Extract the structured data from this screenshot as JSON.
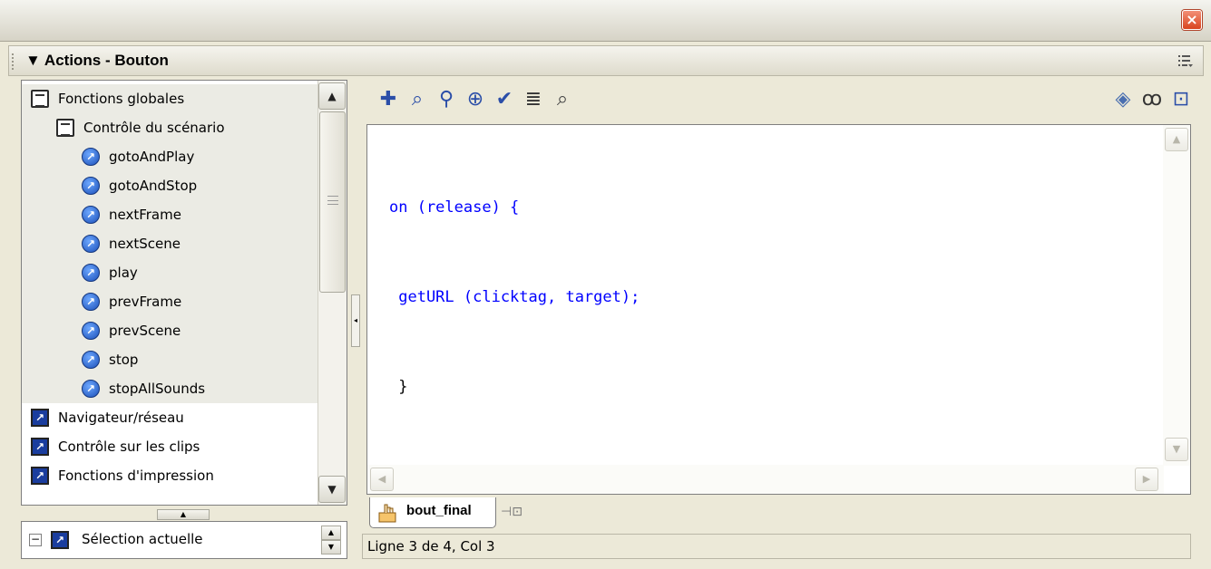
{
  "window": {
    "close_label": "×"
  },
  "panel": {
    "title": "Actions - Bouton"
  },
  "tree": {
    "items": [
      {
        "label": "Fonctions globales",
        "icon": "book-icon",
        "indent": 1
      },
      {
        "label": "Contrôle du scénario",
        "icon": "book-icon",
        "indent": 2
      },
      {
        "label": "gotoAndPlay",
        "icon": "action-circle-icon",
        "indent": 3
      },
      {
        "label": "gotoAndStop",
        "icon": "action-circle-icon",
        "indent": 3
      },
      {
        "label": "nextFrame",
        "icon": "action-circle-icon",
        "indent": 3
      },
      {
        "label": "nextScene",
        "icon": "action-circle-icon",
        "indent": 3
      },
      {
        "label": "play",
        "icon": "action-circle-icon",
        "indent": 3
      },
      {
        "label": "prevFrame",
        "icon": "action-circle-icon",
        "indent": 3
      },
      {
        "label": "prevScene",
        "icon": "action-circle-icon",
        "indent": 3
      },
      {
        "label": "stop",
        "icon": "action-circle-icon",
        "indent": 3
      },
      {
        "label": "stopAllSounds",
        "icon": "action-circle-icon",
        "indent": 3
      },
      {
        "label": "Navigateur/réseau",
        "icon": "action-square-icon",
        "indent": 1
      },
      {
        "label": "Contrôle sur les clips",
        "icon": "action-square-icon",
        "indent": 1
      },
      {
        "label": "Fonctions d'impression",
        "icon": "action-square-icon",
        "indent": 1
      }
    ]
  },
  "selection": {
    "label": "Sélection actuelle"
  },
  "toolbar": {
    "left_icons": [
      "add-icon",
      "find-icon",
      "replace-icon",
      "target-icon",
      "check-syntax-icon",
      "auto-format-icon",
      "code-hint-icon"
    ],
    "right_icons": [
      "reference-icon",
      "debug-options-icon",
      "script-assist-icon"
    ]
  },
  "code": {
    "lines": [
      "on (release) {",
      " getURL (clicktag, target);",
      " }"
    ]
  },
  "tab": {
    "label": "bout_final"
  },
  "status": {
    "text": "Ligne 3 de 4, Col 3"
  },
  "colors": {
    "keyword": "#0000ff",
    "close": "#d9451f",
    "icon_blue": "#1b4fb8"
  }
}
